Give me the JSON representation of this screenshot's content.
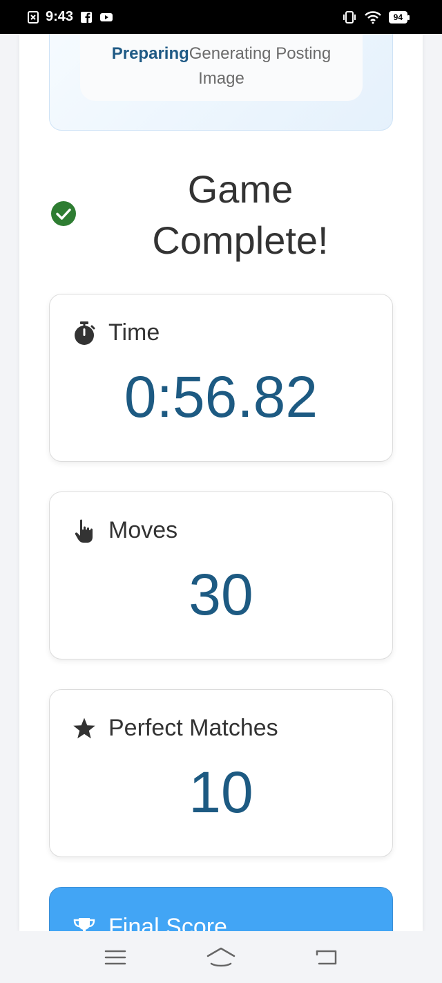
{
  "status_bar": {
    "time": "9:43",
    "battery": "94"
  },
  "progress": {
    "steps": [
      "Preparing",
      "Generating",
      "Posting"
    ],
    "active_step": "Preparing",
    "subtitle": "Image"
  },
  "result": {
    "title_line1": "Game",
    "title_line2": "Complete!"
  },
  "stats": {
    "time": {
      "label": "Time",
      "value": "0:56.82"
    },
    "moves": {
      "label": "Moves",
      "value": "30"
    },
    "perfect": {
      "label": "Perfect Matches",
      "value": "10"
    }
  },
  "final_score": {
    "label": "Final Score"
  },
  "colors": {
    "accent": "#1d5a82",
    "success": "#2e7d32",
    "final_bg": "#42a5f5"
  }
}
